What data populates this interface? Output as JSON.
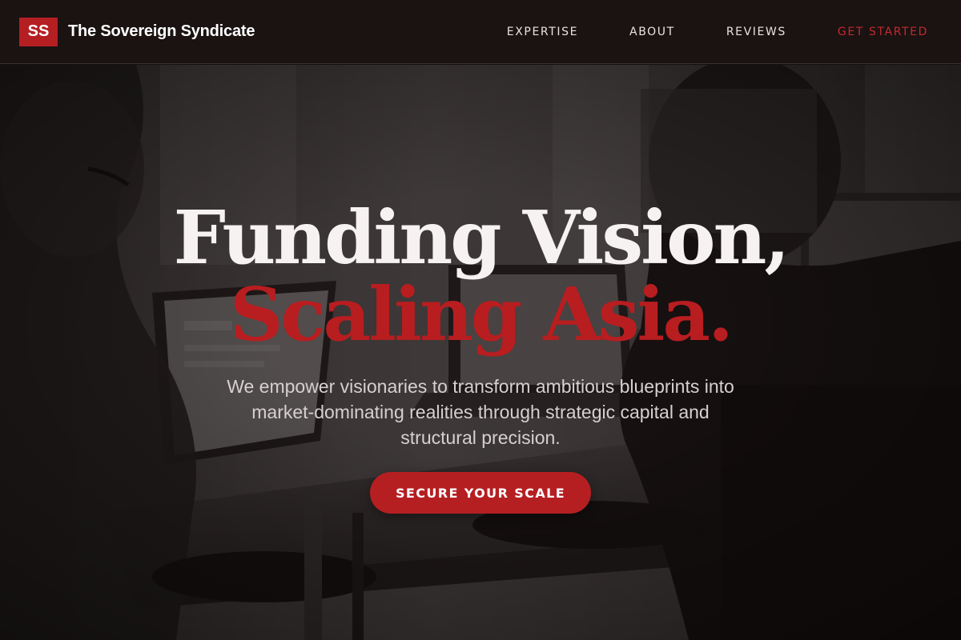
{
  "header": {
    "logo_initials": "SS",
    "brand_name": "The Sovereign Syndicate",
    "nav": [
      {
        "label": "EXPERTISE"
      },
      {
        "label": "ABOUT"
      },
      {
        "label": "REVIEWS"
      }
    ],
    "cta_label": "GET STARTED"
  },
  "hero": {
    "headline_line1": "Funding Vision,",
    "headline_line2": "Scaling Asia.",
    "subtext": "We empower visionaries to transform ambitious blueprints into market-dominating realities through strategic capital and structural precision.",
    "button_label": "SECURE YOUR SCALE"
  },
  "colors": {
    "accent": "#b51f22",
    "nav_background": "#1b1212",
    "headline_white": "#f6f2f2"
  },
  "icons": [
    "logo-badge"
  ]
}
